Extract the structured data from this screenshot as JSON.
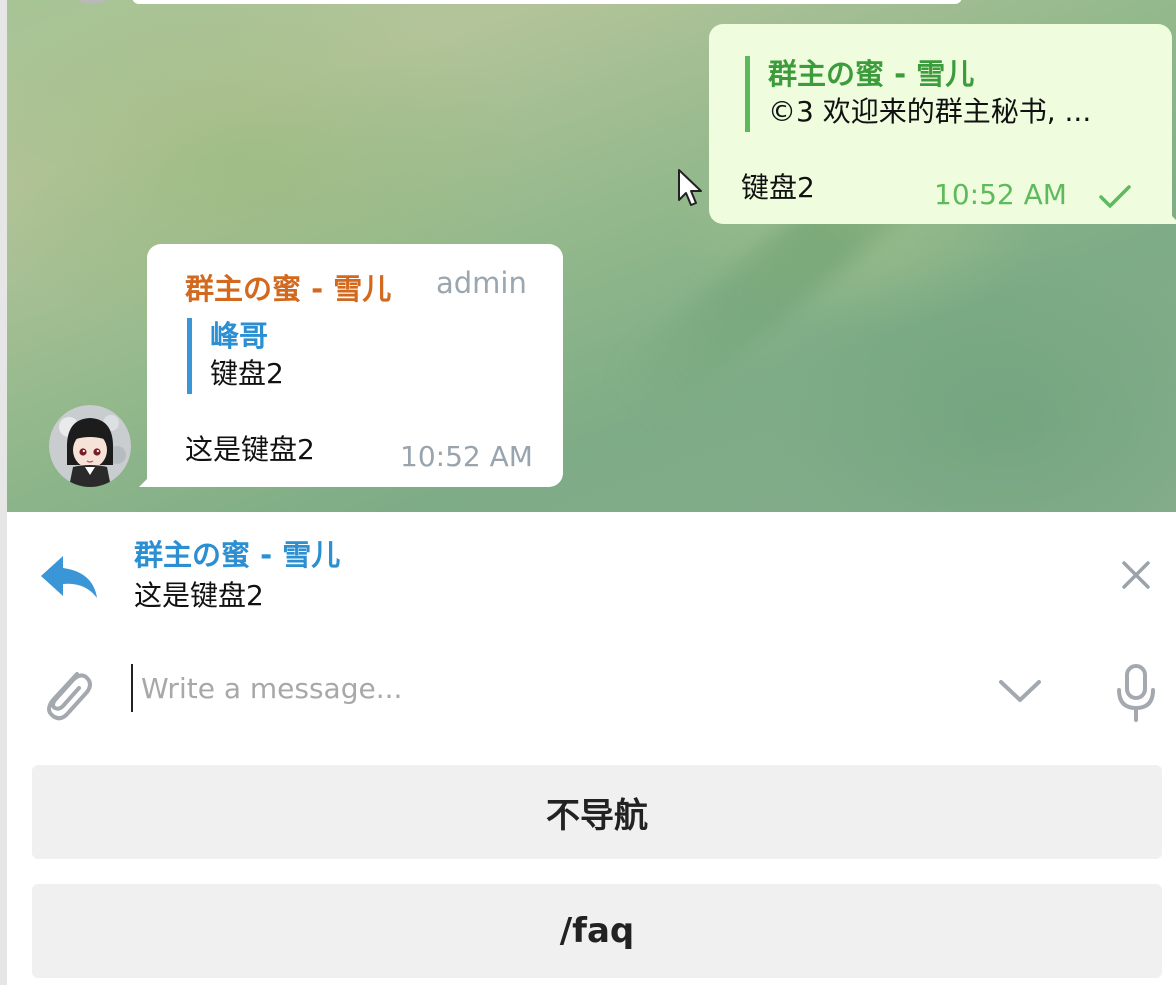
{
  "chat": {
    "outgoing": {
      "quote_author": "群主の蜜 - 雪儿",
      "quote_text": "©3 欢迎来的群主秘书, ...",
      "text": "键盘2",
      "time": "10:52 AM",
      "status_icon": "check-icon"
    },
    "incoming": {
      "sender": "群主の蜜 - 雪儿",
      "role": "admin",
      "quote_author": "峰哥",
      "quote_text": "键盘2",
      "text": "这是键盘2",
      "time": "10:52 AM"
    }
  },
  "reply_bar": {
    "author": "群主の蜜 - 雪儿",
    "text": "这是键盘2",
    "icon": "reply-arrow-icon",
    "close_icon": "close-icon"
  },
  "composer": {
    "placeholder": "Write a message...",
    "value": "",
    "attach_icon": "paperclip-icon",
    "collapse_icon": "chevron-down-icon",
    "voice_icon": "microphone-icon"
  },
  "keyboard": {
    "buttons": [
      {
        "label": "不导航"
      },
      {
        "label": "/faq"
      }
    ]
  },
  "colors": {
    "outgoing_bubble": "#effdde",
    "incoming_bubble": "#ffffff",
    "accent_blue": "#2b8fd1",
    "sender_orange": "#d2691e",
    "quote_green": "#3c9c3c",
    "time_green": "#5dba5d",
    "button_bg": "#f0f0f0"
  }
}
